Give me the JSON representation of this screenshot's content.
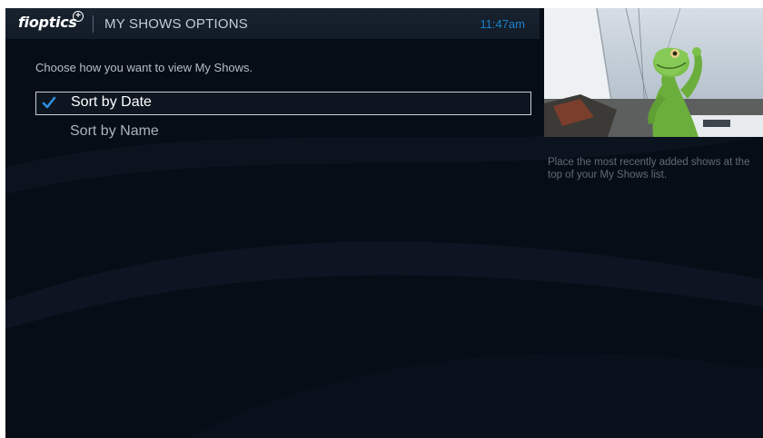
{
  "header": {
    "logo": "fioptics",
    "logo_plus": "+",
    "title": "MY SHOWS OPTIONS",
    "time": "11:47am"
  },
  "main": {
    "instructions": "Choose how you want to view My Shows.",
    "options": [
      {
        "label": "Sort by Date",
        "selected": true,
        "icon": "checkmark-icon"
      },
      {
        "label": "Sort by Name",
        "selected": false
      }
    ]
  },
  "sidebar": {
    "preview_image": "video-preview-gecko-on-sailboat",
    "description": "Place the most recently added shows at the top of your My Shows list."
  },
  "colors": {
    "background": "#070d16",
    "accent": "#1b80c9",
    "check": "#2f8fe0",
    "selected_border": "#c9ced4"
  }
}
